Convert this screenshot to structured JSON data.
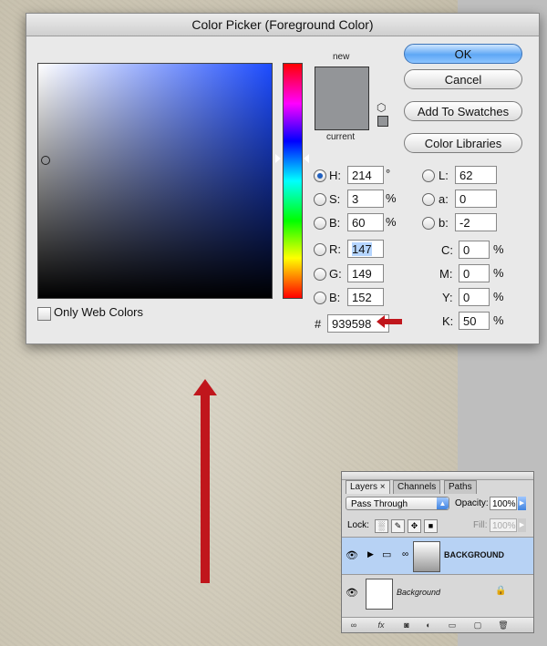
{
  "dialog": {
    "title": "Color Picker (Foreground Color)",
    "new_label": "new",
    "current_label": "current",
    "buttons": {
      "ok": "OK",
      "cancel": "Cancel",
      "add_to_swatches": "Add To Swatches",
      "color_libraries": "Color Libraries"
    },
    "hsb": {
      "h_label": "H:",
      "h": "214",
      "h_unit": "°",
      "s_label": "S:",
      "s": "3",
      "s_unit": "%",
      "b_label": "B:",
      "b": "60",
      "b_unit": "%"
    },
    "rgb": {
      "r_label": "R:",
      "r": "147",
      "g_label": "G:",
      "g": "149",
      "b_label": "B:",
      "b": "152"
    },
    "lab": {
      "l_label": "L:",
      "l": "62",
      "a_label": "a:",
      "a": "0",
      "b_label": "b:",
      "b": "-2"
    },
    "cmyk": {
      "c_label": "C:",
      "c": "0",
      "m_label": "M:",
      "m": "0",
      "y_label": "Y:",
      "y": "0",
      "k_label": "K:",
      "k": "50",
      "unit": "%"
    },
    "hex_label": "#",
    "hex": "939598",
    "only_web_colors": "Only Web Colors",
    "selected_color": "#939598"
  },
  "layers": {
    "tabs": [
      "Layers",
      "Channels",
      "Paths"
    ],
    "tab_close": "×",
    "blend_mode": "Pass Through",
    "opacity_label": "Opacity:",
    "opacity": "100%",
    "lock_label": "Lock:",
    "fill_label": "Fill:",
    "fill": "100%",
    "rows": [
      {
        "name": "BACKGROUND",
        "selected": true
      },
      {
        "name": "Background",
        "selected": false
      }
    ]
  },
  "colors": {
    "arrow_red": "#c0161c",
    "ok_blue": "#5ea7f5",
    "selection_blue": "#b7d2f4"
  },
  "icons": [
    "eye-icon",
    "folder-icon",
    "link-icon",
    "lock-icon",
    "gamut-cube-icon",
    "disclosure-triangle-icon"
  ]
}
